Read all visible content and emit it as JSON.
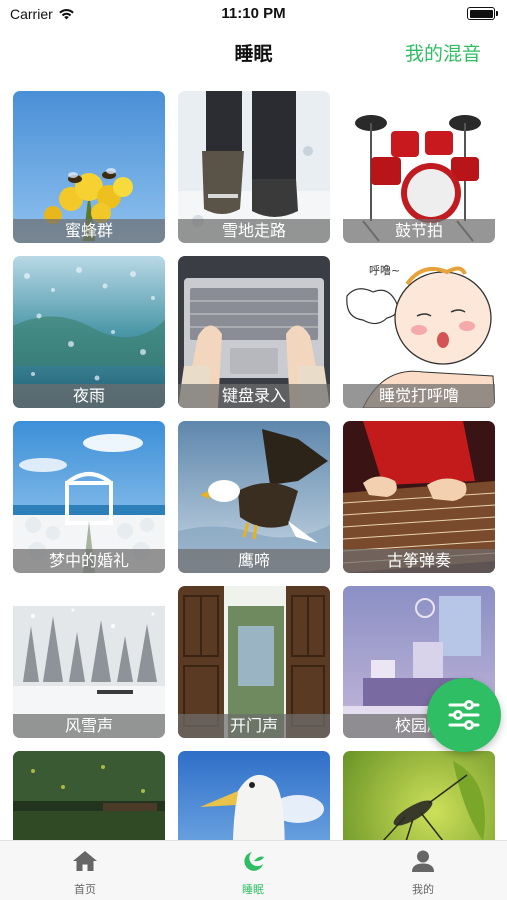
{
  "status_bar": {
    "carrier": "Carrier",
    "time": "11:10 PM"
  },
  "nav": {
    "title": "睡眠",
    "action": "我的混音"
  },
  "tiles": [
    {
      "label": "蜜蜂群"
    },
    {
      "label": "雪地走路"
    },
    {
      "label": "鼓节拍"
    },
    {
      "label": "夜雨"
    },
    {
      "label": "键盘录入"
    },
    {
      "label": "睡觉打呼噜"
    },
    {
      "label": "梦中的婚礼"
    },
    {
      "label": "鹰啼"
    },
    {
      "label": "古筝弹奏"
    },
    {
      "label": "风雪声"
    },
    {
      "label": "开门声"
    },
    {
      "label": "校园越"
    }
  ],
  "bubble_text": "呼噜~",
  "tab_bar": {
    "items": [
      {
        "label": "首页",
        "icon": "home-icon"
      },
      {
        "label": "睡眠",
        "icon": "moon-leaf-icon",
        "active": true
      },
      {
        "label": "我的",
        "icon": "person-icon"
      }
    ]
  },
  "colors": {
    "accent": "#2fbe63"
  }
}
